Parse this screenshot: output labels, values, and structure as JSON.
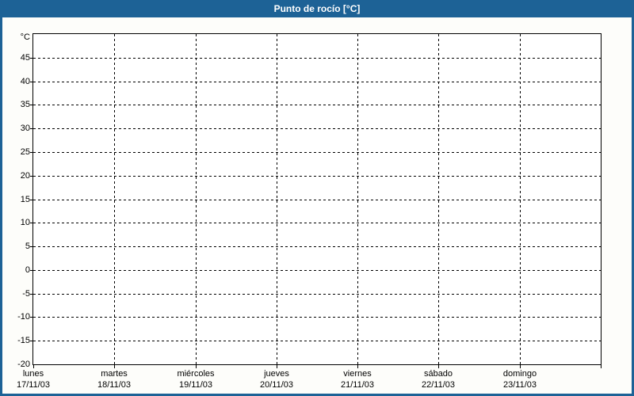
{
  "colors": {
    "accent_blue": "#1d6296",
    "title_text": "#ffffff",
    "grid_line": "#000000",
    "plot_background": "#ffffff",
    "page_background": "#fdfdfa",
    "axis_text": "#000000"
  },
  "chart_data": {
    "type": "line",
    "title": "Punto de rocío [°C]",
    "ylabel": "°C",
    "ylim": [
      -20,
      50
    ],
    "ytick_step": 5,
    "yticks_labeled": [
      45,
      40,
      35,
      30,
      25,
      20,
      15,
      10,
      5,
      0,
      -5,
      -10,
      -15,
      -20
    ],
    "grid": "dashed",
    "legend": "none",
    "x_divisions": 7,
    "x_categories": [
      {
        "day": "lunes",
        "date": "17/11/03"
      },
      {
        "day": "martes",
        "date": "18/11/03"
      },
      {
        "day": "miércoles",
        "date": "19/11/03"
      },
      {
        "day": "jueves",
        "date": "20/11/03"
      },
      {
        "day": "viernes",
        "date": "21/11/03"
      },
      {
        "day": "sábado",
        "date": "22/11/03"
      },
      {
        "day": "domingo",
        "date": "23/11/03"
      }
    ],
    "series": []
  }
}
